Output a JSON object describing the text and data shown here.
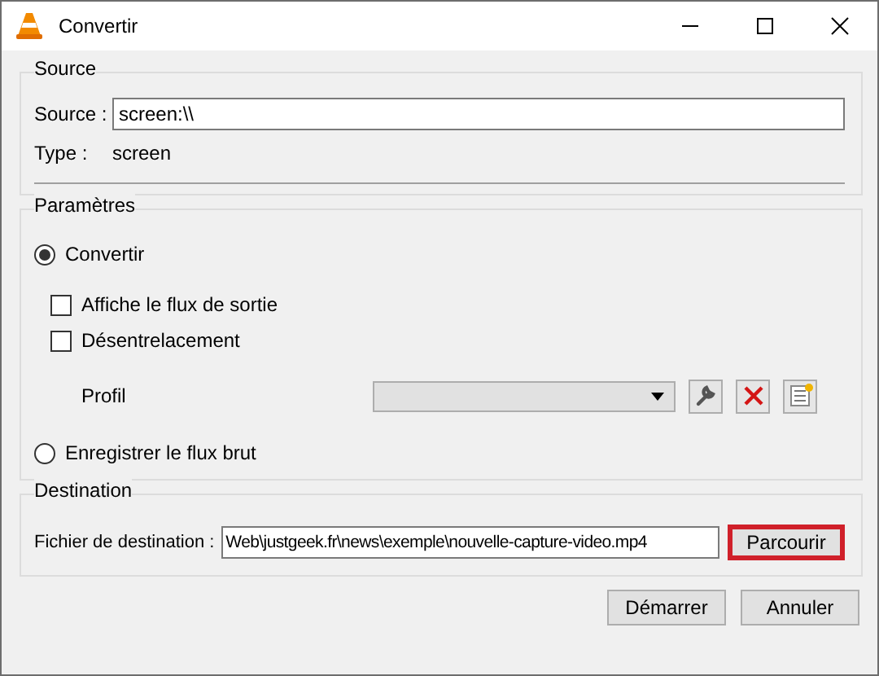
{
  "window": {
    "title": "Convertir"
  },
  "source": {
    "title": "Source",
    "source_label": "Source :",
    "source_value": "screen:\\\\",
    "type_label": "Type :",
    "type_value": "screen"
  },
  "parameters": {
    "title": "Paramètres",
    "convert": {
      "label": "Convertir",
      "selected": true
    },
    "checkboxes": [
      {
        "label": "Affiche le flux de sortie",
        "checked": false
      },
      {
        "label": "Désentrelacement",
        "checked": false
      }
    ],
    "profile": {
      "label": "Profil"
    },
    "raw": {
      "label": "Enregistrer le flux brut",
      "selected": false
    }
  },
  "destination": {
    "title": "Destination",
    "file_label": "Fichier de destination :",
    "file_value": "Web\\justgeek.fr\\news\\exemple\\nouvelle-capture-video.mp4",
    "browse": {
      "label": "Parcourir",
      "highlighted": true
    }
  },
  "buttons": [
    {
      "label": "Démarrer"
    },
    {
      "label": "Annuler"
    }
  ]
}
